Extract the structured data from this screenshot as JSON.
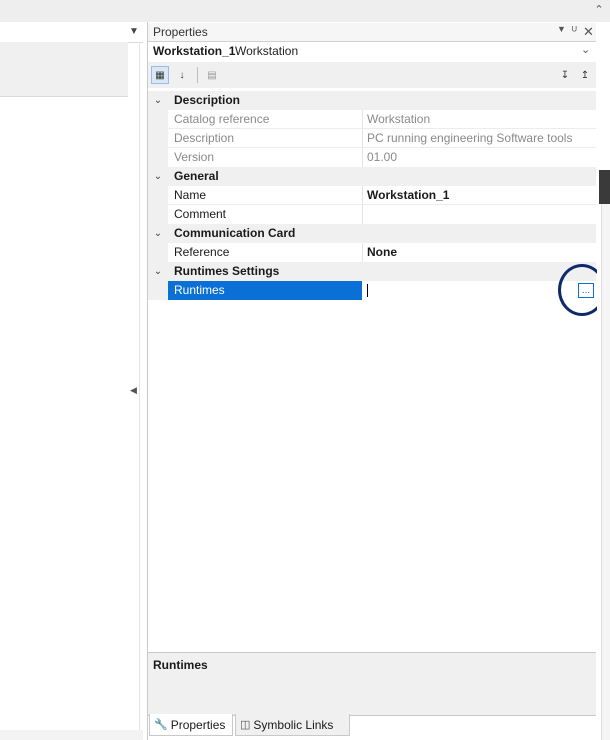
{
  "properties_panel": {
    "title": "Properties",
    "object": {
      "name": "Workstation_1",
      "type": "Workstation"
    },
    "toolbar": {
      "categorized_icon": "categorized-icon",
      "alphabetical_icon": "sort-az-icon",
      "property_pages_icon": "property-pages-icon",
      "expand_icon": "expand-all-icon",
      "collapse_icon": "collapse-all-icon"
    },
    "categories": [
      {
        "label": "Description",
        "props": [
          {
            "label": "Catalog reference",
            "value": "Workstation"
          },
          {
            "label": "Description",
            "value": "PC running engineering Software tools"
          },
          {
            "label": "Version",
            "value": "01.00"
          }
        ]
      },
      {
        "label": "General",
        "props": [
          {
            "label": "Name",
            "value": "Workstation_1"
          },
          {
            "label": "Comment",
            "value": ""
          }
        ]
      },
      {
        "label": "Communication Card",
        "props": [
          {
            "label": "Reference",
            "value": "None"
          }
        ]
      },
      {
        "label": "Runtimes Settings",
        "props": [
          {
            "label": "Runtimes",
            "value": ""
          }
        ]
      }
    ],
    "ellipsis_label": "...",
    "description_pane_title": "Runtimes",
    "tabs": [
      {
        "label": "Properties",
        "icon": "wrench-icon"
      },
      {
        "label": "Symbolic Links",
        "icon": "symbolic-links-icon"
      }
    ]
  },
  "colors": {
    "selection": "#0a70d6",
    "highlight_circle": "#0e2a6b"
  }
}
